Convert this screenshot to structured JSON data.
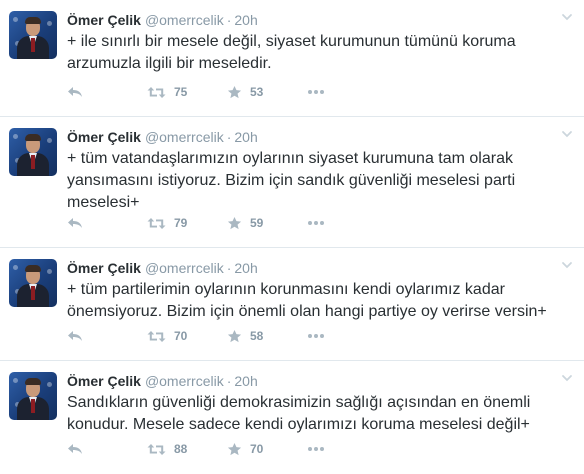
{
  "tweets": [
    {
      "name": "Ömer Çelik",
      "handle": "@omerrcelik",
      "dot": "·",
      "time": "20h",
      "text": "+ ile sınırlı bir mesele değil, siyaset kurumunun tümünü koruma arzumuzla ilgili bir meseledir.",
      "retweets": "75",
      "favorites": "53"
    },
    {
      "name": "Ömer Çelik",
      "handle": "@omerrcelik",
      "dot": "·",
      "time": "20h",
      "text": "+ tüm vatandaşlarımızın oylarının siyaset kurumuna tam olarak yansımasını istiyoruz. Bizim için sandık güvenliği meselesi parti meselesi+",
      "retweets": "79",
      "favorites": "59"
    },
    {
      "name": "Ömer Çelik",
      "handle": "@omerrcelik",
      "dot": "·",
      "time": "20h",
      "text": "+ tüm partilerimin oylarının korunmasını kendi oylarımız kadar önemsiyoruz. Bizim için önemli olan hangi partiye oy verirse versin+",
      "retweets": "70",
      "favorites": "58"
    },
    {
      "name": "Ömer Çelik",
      "handle": "@omerrcelik",
      "dot": "·",
      "time": "20h",
      "text": "Sandıkların güvenliği demokrasimizin sağlığı açısından en önemli konudur. Mesele sadece kendi oylarımızı koruma meselesi değil+",
      "retweets": "88",
      "favorites": "70"
    }
  ],
  "icons": {
    "reply": "reply-icon",
    "retweet": "retweet-icon",
    "favorite": "star-icon",
    "more": "more-icon",
    "menu": "chevron-down-icon"
  },
  "colors": {
    "text": "#292f33",
    "muted": "#8899a6",
    "icon": "#aab8c2",
    "divider": "#e1e8ed"
  }
}
